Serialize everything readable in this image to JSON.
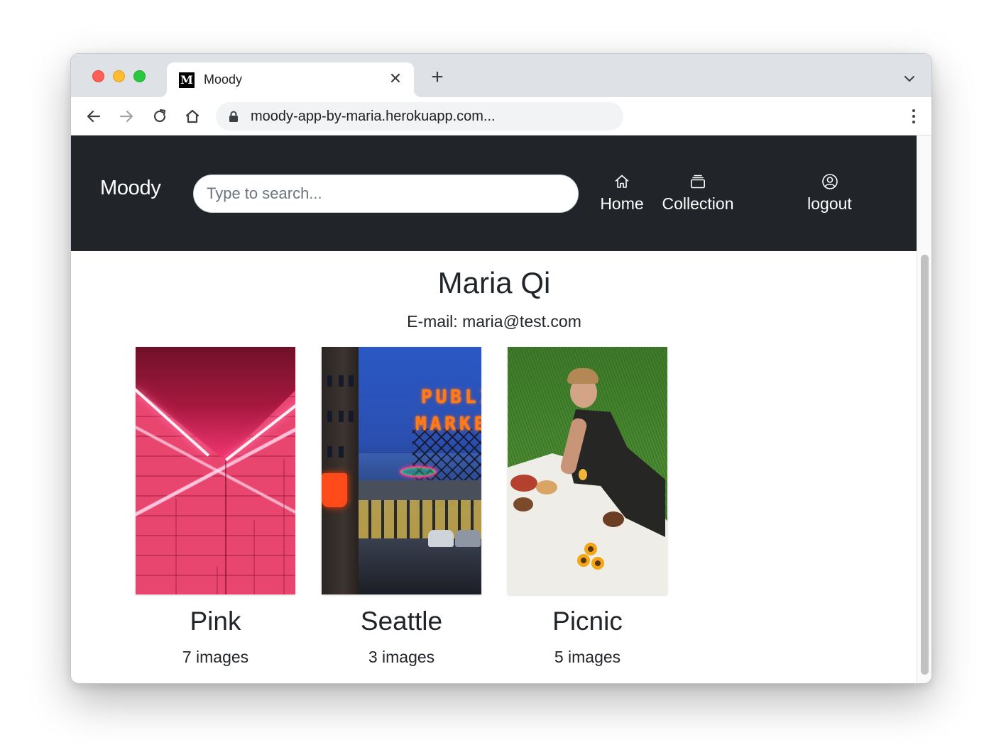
{
  "browser": {
    "tab_title": "Moody",
    "tab_favicon": "M",
    "url": "moody-app-by-maria.herokuapp.com..."
  },
  "navbar": {
    "brand": "Moody",
    "search_placeholder": "Type to search...",
    "links": [
      {
        "label": "Home",
        "icon": "house-icon"
      },
      {
        "label": "Collection",
        "icon": "collection-icon"
      },
      {
        "label": "logout",
        "icon": "user-circle-icon"
      }
    ]
  },
  "profile": {
    "name": "Maria Qi",
    "email": "E-mail: maria@test.com"
  },
  "collections": [
    {
      "title": "Pink",
      "count": "7 images",
      "image": "pink-neon-brick-wall"
    },
    {
      "title": "Seattle",
      "count": "3 images",
      "image": "pike-place-public-market-sign"
    },
    {
      "title": "Picnic",
      "count": "5 images",
      "image": "woman-at-picnic-on-grass"
    }
  ],
  "colors": {
    "navbar_bg": "#212529",
    "text": "#212529",
    "tab_strip_bg": "#dee1e6"
  }
}
